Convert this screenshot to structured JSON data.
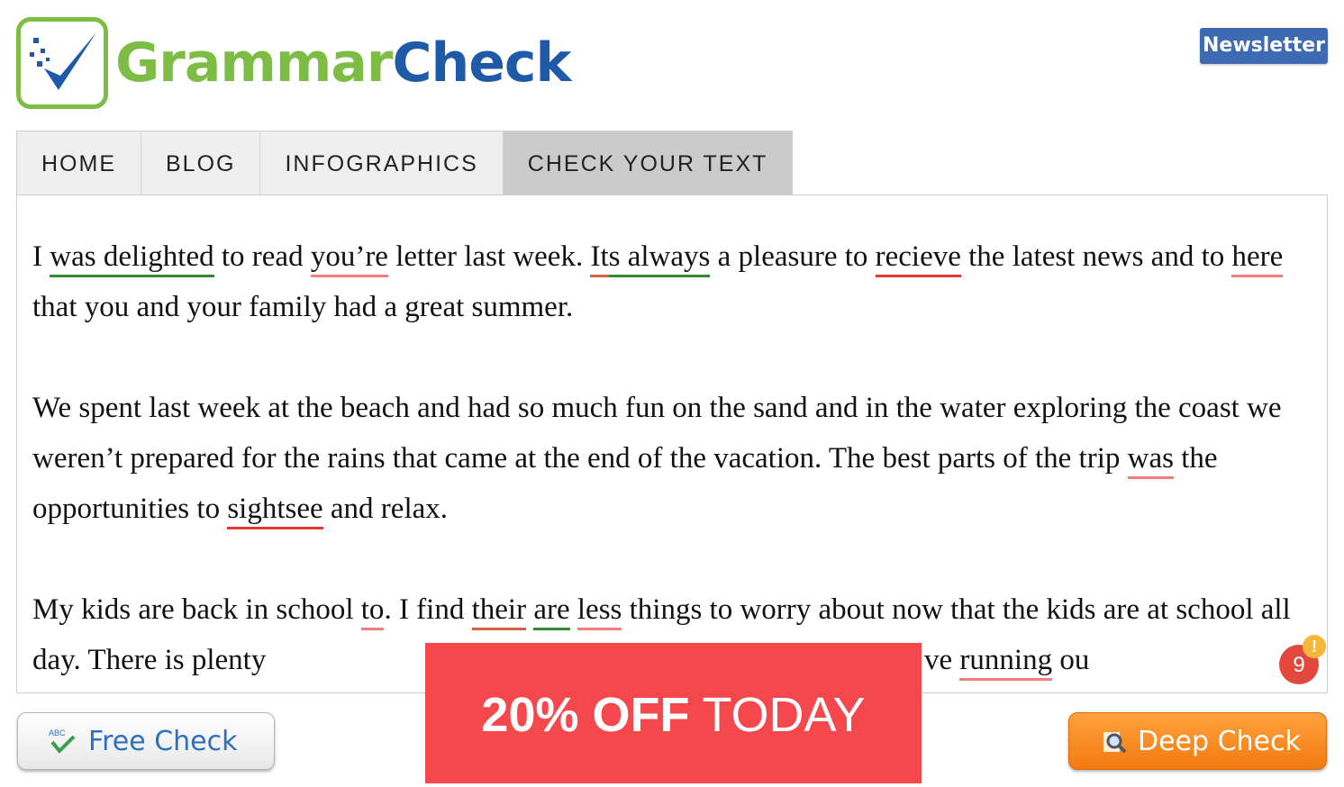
{
  "logo": {
    "part1": "Grammar",
    "part2": "Check"
  },
  "header": {
    "newsletter_label": "Newsletter"
  },
  "nav": {
    "tabs": [
      {
        "label": "HOME"
      },
      {
        "label": "BLOG"
      },
      {
        "label": "INFOGRAPHICS"
      },
      {
        "label": "CHECK YOUR TEXT"
      }
    ]
  },
  "editor": {
    "p1": {
      "t1": "I ",
      "w1": "was delighted",
      "t2": " to read ",
      "w2": "you’re",
      "t3": " letter last week. ",
      "w3": "It",
      "w4": "s always",
      "t4": " a pleasure to ",
      "w5": "recieve",
      "t5": " the latest news and to ",
      "w6": "here",
      "t6": " that you and your family had a great summer."
    },
    "p2": {
      "t1": "We spent last week at the beach and had so much fun on the sand and in the water exploring the coast we weren’t prepared for the rains that came at the end of the vacation. The best parts of the trip ",
      "w1": "was",
      "t2": " the opportunities to ",
      "w2": "sightsee",
      "t3": " and relax."
    },
    "p3": {
      "t1": "My kids are back in school ",
      "w1": "to",
      "t2": ". I find ",
      "w2": "their",
      "t3": " ",
      "w3": "are",
      "t4": " ",
      "w4": "less",
      "t5": " things to worry about now that the kids are at school all day.  There is plenty",
      "hidden": "",
      "t6": "t by August, I’ve ",
      "w5": "running",
      "t7": " ou"
    }
  },
  "issue_badge": {
    "count": "9",
    "alert": "!"
  },
  "buttons": {
    "free_check": "Free Check",
    "deep_check": "Deep Check"
  },
  "promo": {
    "bold": "20% OFF",
    "rest": " TODAY"
  },
  "colors": {
    "logo_green": "#7dbd45",
    "logo_blue": "#1e5aa8",
    "spelling_error": "#e53935",
    "grammar_error": "#2e8b2e",
    "promo_red": "#f5484d",
    "deep_check_orange": "#f37a10"
  }
}
